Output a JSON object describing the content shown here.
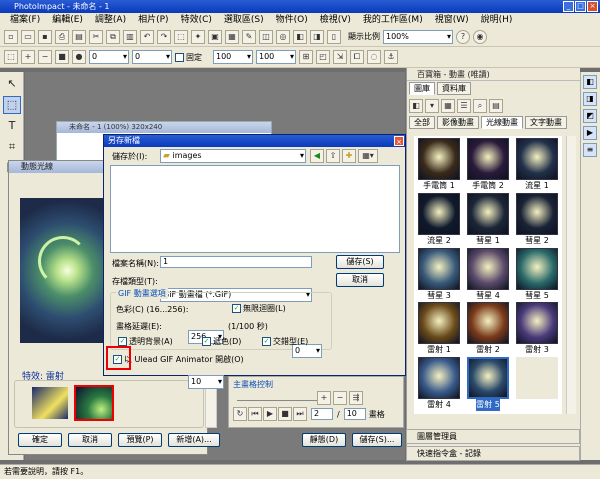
{
  "app": {
    "title": "PhotoImpact - 未命名 - 1"
  },
  "menu": [
    "檔案(F)",
    "編輯(E)",
    "調整(A)",
    "相片(P)",
    "特效(C)",
    "選取區(S)",
    "物件(O)",
    "檢視(V)",
    "我的工作區(M)",
    "視窗(W)",
    "說明(H)"
  ],
  "toolbar1": {
    "zoom_label": "顯示比例",
    "zoom_value": "100%"
  },
  "toolbar2": {
    "value_a": "0",
    "value_b": "0",
    "fixed_label": "固定",
    "value_c": "100",
    "value_d": "100"
  },
  "doc_window": {
    "title": "未命名 - 1 (100%) 320x240"
  },
  "effects_window": {
    "title": "動態光線",
    "effects_label": "特效: 雷射",
    "buttons": {
      "ok": "確定",
      "cancel": "取消",
      "preview": "預覽(P)",
      "new": "新增(A)...",
      "dialog": "靜態(D)",
      "save": "儲存(S)..."
    }
  },
  "save_dialog": {
    "title": "另存新檔",
    "save_in_label": "儲存於(I):",
    "save_in_value": "images",
    "filename_label": "檔案名稱(N):",
    "filename_value": "1",
    "filetype_label": "存檔類型(T):",
    "filetype_value": "GIF 動畫檔 (*.GIF)",
    "save_button": "儲存(S)",
    "cancel_button": "取消",
    "gif_group_title": "GIF 動畫選項",
    "colors_label": "色彩(C) (16...256):",
    "colors_value": "256",
    "loop_label": "無限迴圈(L)",
    "loop_value": "0",
    "delay_label": "畫格延遲(E):",
    "delay_value": "10",
    "delay_unit": "(1/100 秒)",
    "transparent_label": "透明背景(A)",
    "dither_label": "遞色(D)",
    "interlace_label": "交錯型(E)",
    "ulead_label": "以 Ulead GIF Animator 開啟(O)"
  },
  "frame_control": {
    "title": "主畫格控制",
    "current": "2",
    "sep": "/",
    "total": "10",
    "unit": "畫格"
  },
  "right_panel": {
    "title": "百寶箱 - 動畫 (唯讀)",
    "tabs_top": [
      "圖庫",
      "資料庫"
    ],
    "tabs_bottom": [
      "全部",
      "影像動畫",
      "光線動畫",
      "文字動畫"
    ],
    "items": [
      {
        "label": "手電筒 1",
        "color": "#3a2a1a"
      },
      {
        "label": "手電筒 2",
        "color": "#2a1a3a"
      },
      {
        "label": "流星 1",
        "color": "#22304a"
      },
      {
        "label": "流星 2",
        "color": "#101a2c"
      },
      {
        "label": "彗星 1",
        "color": "#1c2638"
      },
      {
        "label": "彗星 2",
        "color": "#1a2236"
      },
      {
        "label": "彗星 3",
        "color": "#3a5a7a"
      },
      {
        "label": "彗星 4",
        "color": "#5a4a6a"
      },
      {
        "label": "彗星 5",
        "color": "#2a6a6a"
      },
      {
        "label": "雷射 1",
        "color": "#6a4a1a"
      },
      {
        "label": "雷射 2",
        "color": "#7a3a1a"
      },
      {
        "label": "雷射 3",
        "color": "#4a3a7a"
      },
      {
        "label": "雷射 4",
        "color": "#3a5a8a"
      },
      {
        "label": "雷射 5",
        "color": "#2a4a6a"
      },
      {
        "label": "",
        "color": "#ece9d8"
      }
    ],
    "layer_manager": "圖層管理員",
    "quick_cmd": "快速指令盒 - 記錄"
  },
  "status": {
    "text": "若需要說明，請按 F1。"
  }
}
